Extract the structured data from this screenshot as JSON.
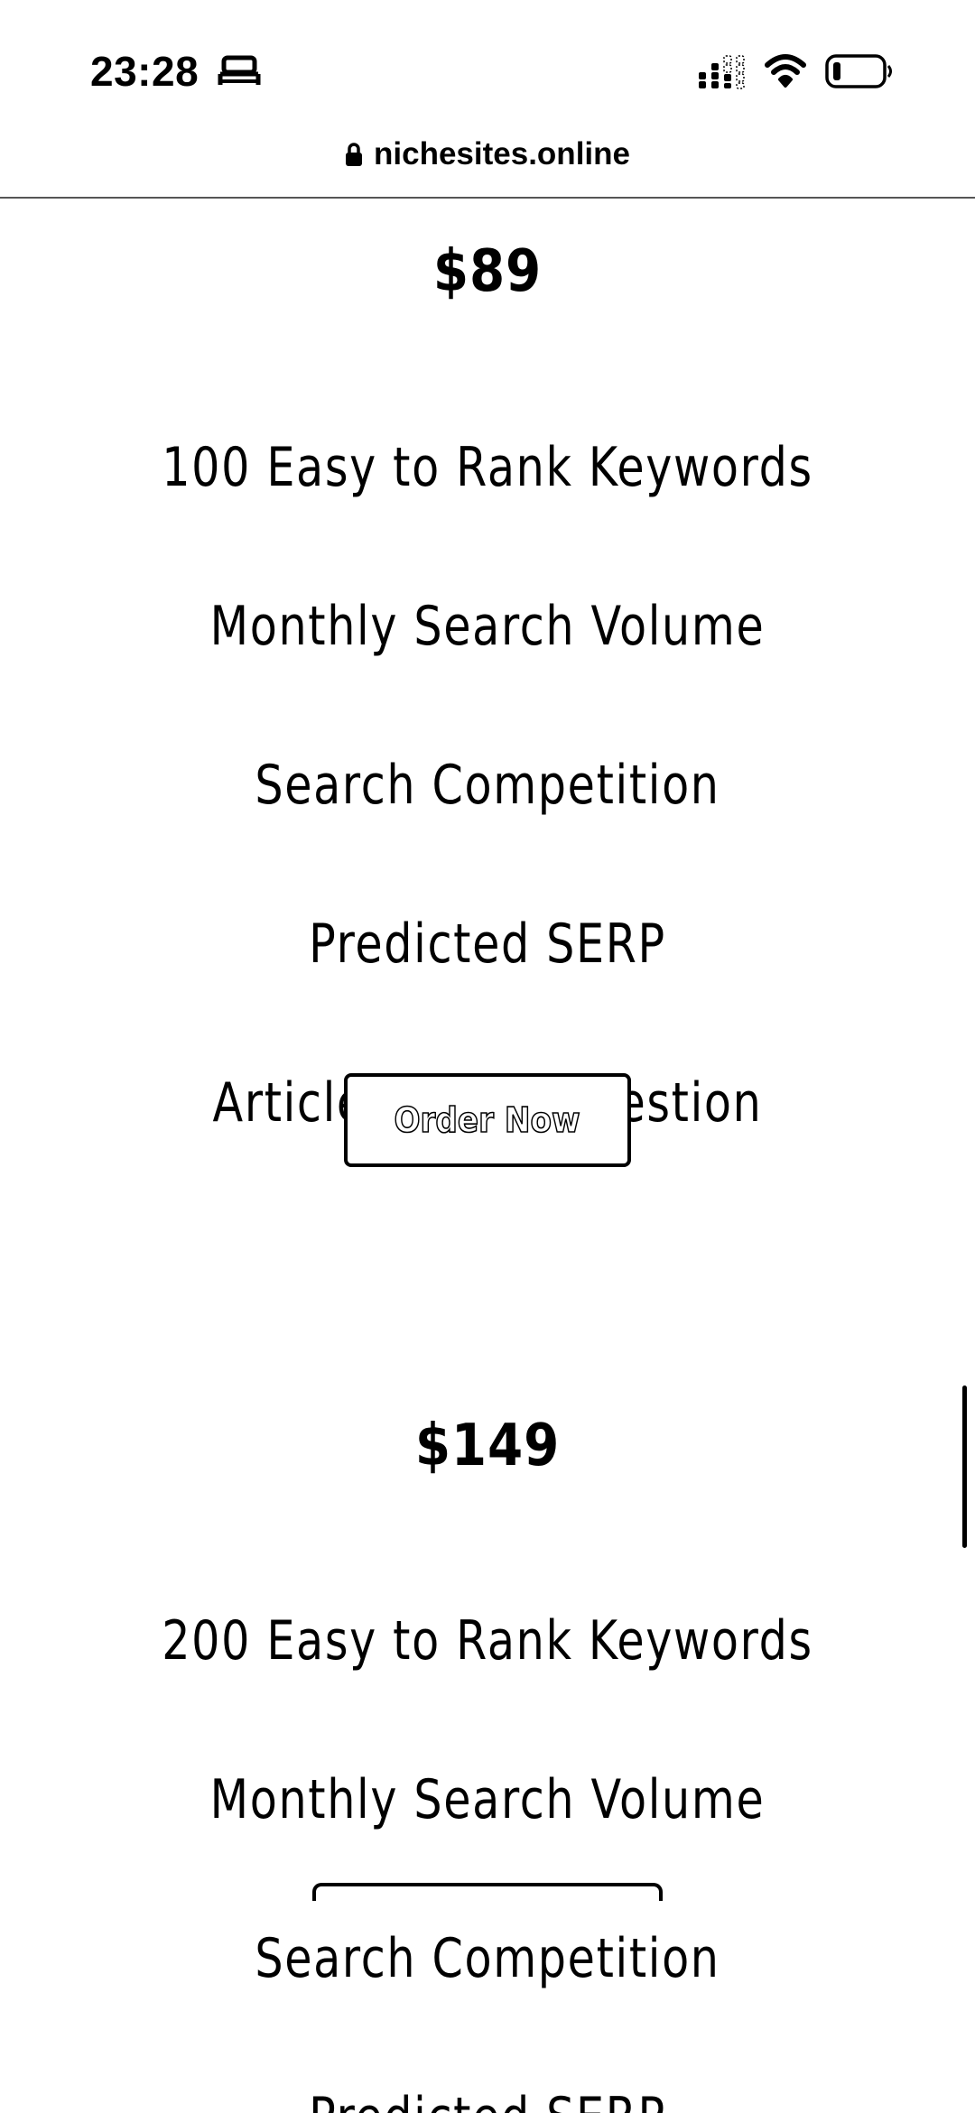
{
  "status_bar": {
    "time": "23:28"
  },
  "browser": {
    "url": "nichesites.online"
  },
  "plans": [
    {
      "price": "$89",
      "features": [
        "100 Easy to Rank Keywords",
        "Monthly Search Volume",
        "Search Competition",
        "Predicted SERP",
        "Article Title Suggestion"
      ],
      "button_label": "Order Now"
    },
    {
      "price": "$149",
      "features": [
        "200 Easy to Rank Keywords",
        "Monthly Search Volume",
        "Search Competition",
        "Predicted SERP"
      ]
    }
  ],
  "icons": {
    "sleep": "bed-icon",
    "signal": "cellular-signal-icon",
    "wifi": "wifi-icon",
    "battery": "battery-icon",
    "lock": "lock-icon"
  },
  "colors": {
    "text": "#000000",
    "background": "#ffffff"
  }
}
